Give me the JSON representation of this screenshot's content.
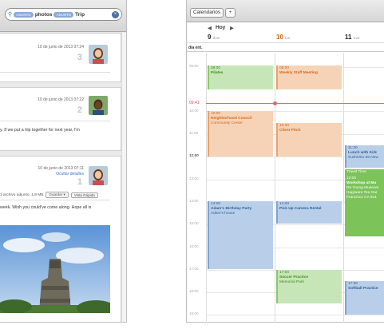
{
  "mail": {
    "search": {
      "token1": "ASUNTO",
      "term1": "photos",
      "token2": "ASUNTO",
      "term2": "Trip"
    },
    "messages": [
      {
        "date": "10 de junio de 2013 07:24",
        "index": "3",
        "body": ""
      },
      {
        "date": "10 de junio de 2013 07:22",
        "index": "2",
        "body": "y. If we put a trip together for next year, I'm"
      },
      {
        "date": "10 de junio de 2013 07:11",
        "index": "1",
        "hide_details": "Ocultar detalles",
        "attachment_text": "1 archivo adjunto, 1,8 MB",
        "save_label": "Guardar ▾",
        "quicklook_label": "Vista Rápida",
        "body": "week. Wish you could've come along. Hope all is"
      }
    ]
  },
  "calendar": {
    "calendars_label": "Calendarios",
    "add_label": "+",
    "today_label": "Hoy",
    "days": [
      {
        "num": "9",
        "name": "dom"
      },
      {
        "num": "10",
        "name": "lun"
      },
      {
        "num": "11",
        "name": "mar"
      }
    ],
    "allday_label": "día ent.",
    "hours": [
      "09:00",
      "10:00",
      "11:00",
      "12:00",
      "13:00",
      "14:00",
      "15:00",
      "16:00",
      "17:00",
      "18:00",
      "19:00"
    ],
    "now_label": "09:41",
    "events": {
      "pilates": {
        "time": "08:00",
        "title": "Pilates"
      },
      "weekly_staff": {
        "time": "08:00",
        "title": "Weekly Staff Meeting"
      },
      "neighborhood": {
        "time": "10:00",
        "title": "Neighborhood Council",
        "location": "Community Center"
      },
      "client_pitch": {
        "time": "10:30",
        "title": "Client Pitch"
      },
      "lunch_kirk": {
        "time": "11:30",
        "title": "Lunch with Kirk",
        "location": "Sushirrito 59 New"
      },
      "travel": {
        "title": "Travel Time"
      },
      "workshop": {
        "time": "13:00",
        "title": "Workshop at Mu",
        "location_lines": [
          "De Young Museum",
          "Hagiwara Tea Gar",
          "Francisco CA 941"
        ]
      },
      "birthday": {
        "time": "14:00",
        "title": "Adam's Birthday Party",
        "location": "Adam's house"
      },
      "camera": {
        "time": "14:00",
        "title": "Pick Up Camera Rental"
      },
      "soccer": {
        "time": "17:00",
        "title": "Soccer Practice",
        "location": "Memorial Park"
      },
      "softball": {
        "time": "17:30",
        "title": "Softball Practice"
      }
    }
  },
  "colors": {
    "accent_blue": "#3a78c2",
    "now_red": "#e06a6a"
  }
}
